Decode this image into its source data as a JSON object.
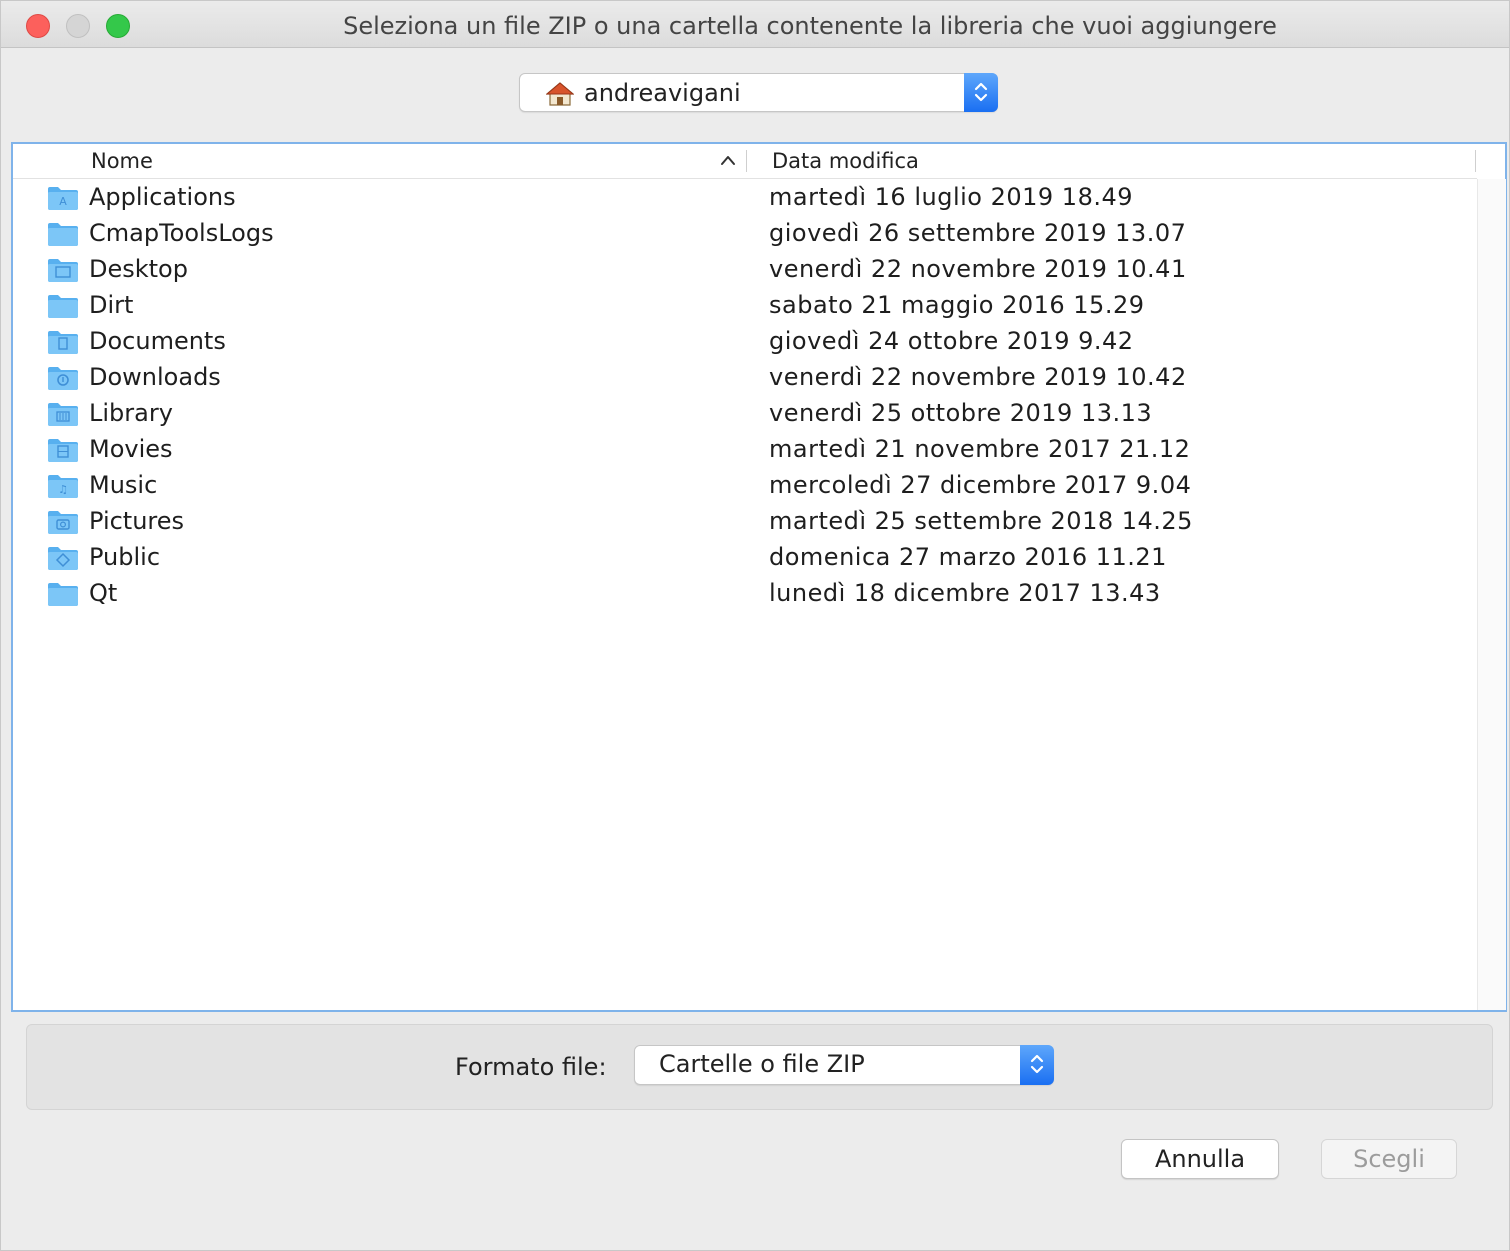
{
  "window": {
    "title": "Seleziona un file ZIP o una cartella contenente la libreria che vuoi aggiungere"
  },
  "location": {
    "current": "andreavigani",
    "icon": "home-icon"
  },
  "columns": {
    "name": "Nome",
    "date": "Data modifica"
  },
  "files": [
    {
      "name": "Applications",
      "date": "martedì 16 luglio 2019 18.49",
      "icon": "applications-folder-icon"
    },
    {
      "name": "CmapToolsLogs",
      "date": "giovedì 26 settembre 2019 13.07",
      "icon": "folder-icon"
    },
    {
      "name": "Desktop",
      "date": "venerdì 22 novembre 2019 10.41",
      "icon": "desktop-folder-icon"
    },
    {
      "name": "Dirt",
      "date": "sabato 21 maggio 2016 15.29",
      "icon": "folder-icon"
    },
    {
      "name": "Documents",
      "date": "giovedì 24 ottobre 2019 9.42",
      "icon": "documents-folder-icon"
    },
    {
      "name": "Downloads",
      "date": "venerdì 22 novembre 2019 10.42",
      "icon": "downloads-folder-icon"
    },
    {
      "name": "Library",
      "date": "venerdì 25 ottobre 2019 13.13",
      "icon": "library-folder-icon"
    },
    {
      "name": "Movies",
      "date": "martedì 21 novembre 2017 21.12",
      "icon": "movies-folder-icon"
    },
    {
      "name": "Music",
      "date": "mercoledì 27 dicembre 2017 9.04",
      "icon": "music-folder-icon"
    },
    {
      "name": "Pictures",
      "date": "martedì 25 settembre 2018 14.25",
      "icon": "pictures-folder-icon"
    },
    {
      "name": "Public",
      "date": "domenica 27 marzo 2016 11.21",
      "icon": "public-folder-icon"
    },
    {
      "name": "Qt",
      "date": "lunedì 18 dicembre 2017 13.43",
      "icon": "folder-icon"
    }
  ],
  "format": {
    "label": "Formato file:",
    "selected": "Cartelle o file ZIP"
  },
  "buttons": {
    "cancel": "Annulla",
    "choose": "Scegli"
  },
  "colors": {
    "accent": "#1a6ff2",
    "folder": "#6cbcf4",
    "close": "#fc605c",
    "maximize": "#34c84a"
  }
}
